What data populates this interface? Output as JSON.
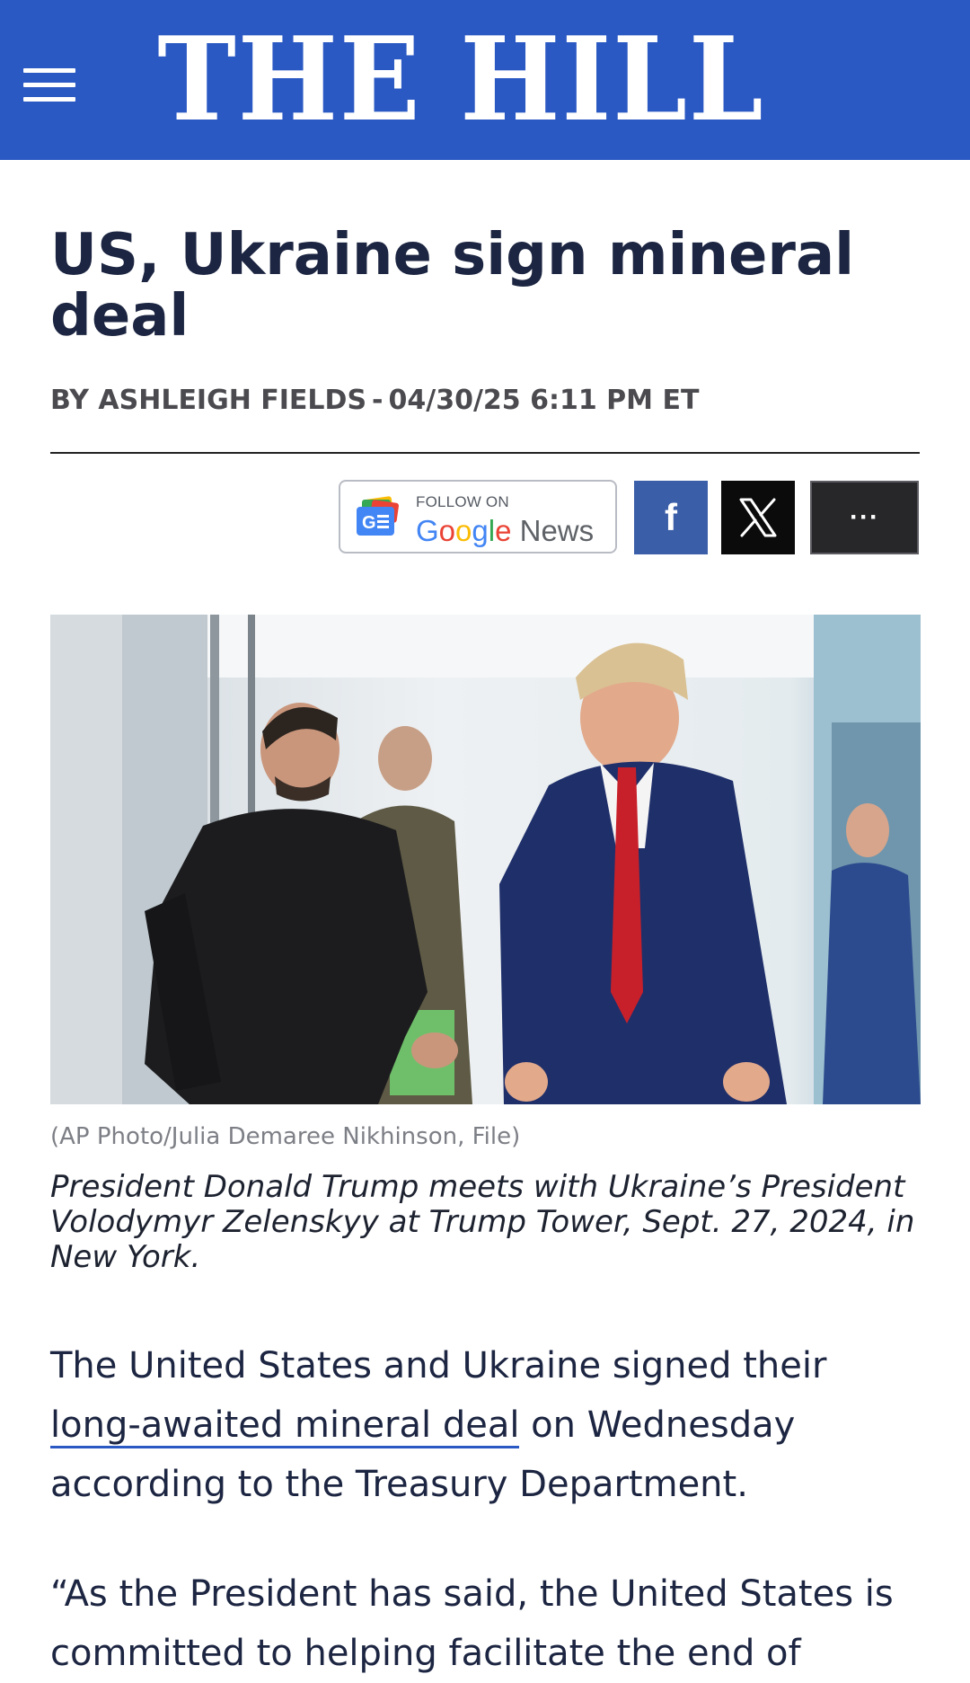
{
  "header": {
    "logo_text": "THE HILL",
    "background_color": "#2b59c3"
  },
  "article": {
    "title": "US, Ukraine sign mineral deal",
    "byline_author": "BY ASHLEIGH FIELDS",
    "byline_separator": "-",
    "byline_datetime": "04/30/25 6:11 PM ET",
    "image_credit": "(AP Photo/Julia Demaree Nikhinson, File)",
    "image_caption": "President Donald Trump meets with Ukraine’s President Volodymyr Zelenskyy at Trump Tower, Sept. 27, 2024, in New York.",
    "paragraph_1_before_link": "The United States and Ukraine signed their ",
    "paragraph_1_link": "long-awaited mineral deal",
    "paragraph_1_after_link": " on Wednesday according to the Treasury Department.",
    "paragraph_2": "“As the President has said, the United States is committed to helping facilitate the end of"
  },
  "share": {
    "google_follow_on": "FOLLOW ON",
    "google_word": [
      "G",
      "o",
      "o",
      "g",
      "l",
      "e"
    ],
    "google_news": " News",
    "facebook_glyph": "f",
    "more_glyph": "···",
    "icons": [
      "google-news-icon",
      "facebook-icon",
      "x-icon",
      "more-icon"
    ]
  }
}
